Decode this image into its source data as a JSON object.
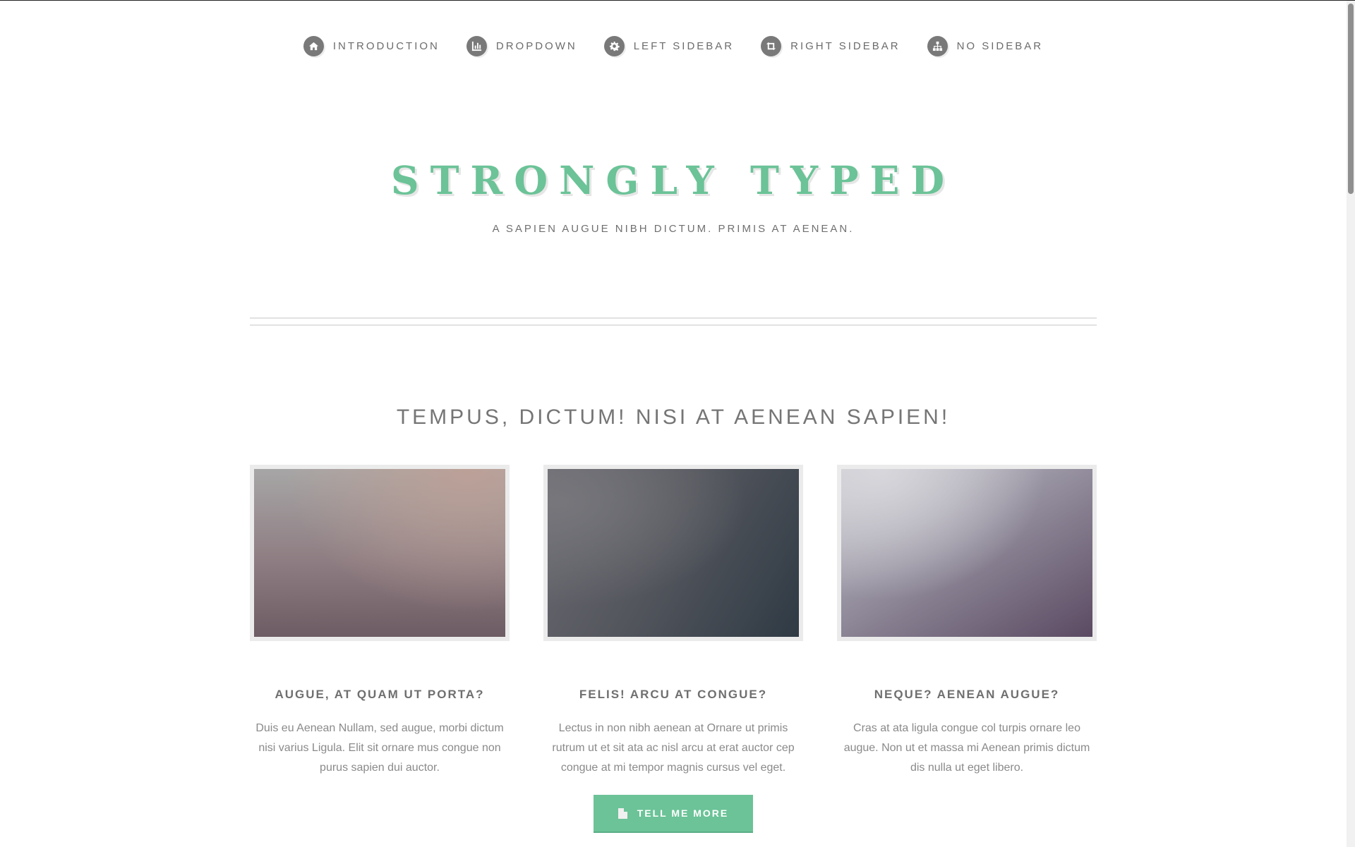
{
  "nav": {
    "items": [
      {
        "label": "Introduction",
        "icon": "home-icon"
      },
      {
        "label": "Dropdown",
        "icon": "bar-chart-icon"
      },
      {
        "label": "Left Sidebar",
        "icon": "gear-icon"
      },
      {
        "label": "Right Sidebar",
        "icon": "retweet-icon"
      },
      {
        "label": "No Sidebar",
        "icon": "sitemap-icon"
      }
    ]
  },
  "header": {
    "title": "STRONGLY TYPED",
    "tagline": "A SAPIEN AUGUE NIBH DICTUM. PRIMIS AT AENEAN."
  },
  "features": {
    "heading": "TEMPUS, DICTUM! NISI AT AENEAN SAPIEN!",
    "cards": [
      {
        "title": "AUGUE, AT QUAM UT PORTA?",
        "text": "Duis eu Aenean Nullam, sed augue, morbi dictum nisi varius Ligula. Elit sit ornare mus congue non purus sapien dui auctor."
      },
      {
        "title": "FELIS! ARCU AT CONGUE?",
        "text": "Lectus in non nibh aenean at Ornare ut primis rutrum ut et sit ata ac nisl arcu at erat auctor cep congue at mi tempor magnis cursus vel eget."
      },
      {
        "title": "NEQUE? AENEAN AUGUE?",
        "text": "Cras at ata ligula congue col turpis ornare leo augue. Non ut et massa mi Aenean primis dictum dis nulla ut eget libero."
      }
    ],
    "button_label": "TELL ME MORE"
  },
  "colors": {
    "accent": "#6bc397",
    "nav_icon_bg": "#797979",
    "text": "#888888"
  }
}
